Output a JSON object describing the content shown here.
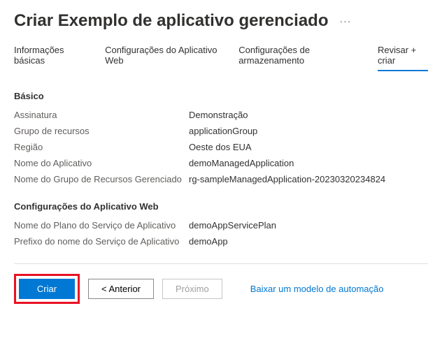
{
  "header": {
    "title": "Criar Exemplo de aplicativo gerenciado",
    "ellipsis": "···"
  },
  "tabs": [
    {
      "label": "Informações básicas"
    },
    {
      "label": "Configurações do Aplicativo Web"
    },
    {
      "label": "Configurações de armazenamento"
    },
    {
      "label": "Revisar + criar"
    }
  ],
  "sections": {
    "basic": {
      "heading": "Básico",
      "rows": [
        {
          "label": "Assinatura",
          "value": "Demonstração"
        },
        {
          "label": "Grupo de recursos",
          "value": "applicationGroup"
        },
        {
          "label": "Região",
          "value": "Oeste dos EUA"
        },
        {
          "label": "Nome do Aplicativo",
          "value": "demoManagedApplication"
        },
        {
          "label": "Nome do Grupo de Recursos Gerenciado",
          "value": "rg-sampleManagedApplication-20230320234824"
        }
      ]
    },
    "webapp": {
      "heading": "Configurações do Aplicativo Web",
      "rows": [
        {
          "label": "Nome do Plano do Serviço de Aplicativo",
          "value": "demoAppServicePlan"
        },
        {
          "label": "Prefixo do nome do Serviço de Aplicativo",
          "value": "demoApp"
        }
      ]
    }
  },
  "footer": {
    "create": "Criar",
    "previous": "< Anterior",
    "next": "Próximo",
    "download_link": "Baixar um modelo de automação"
  }
}
